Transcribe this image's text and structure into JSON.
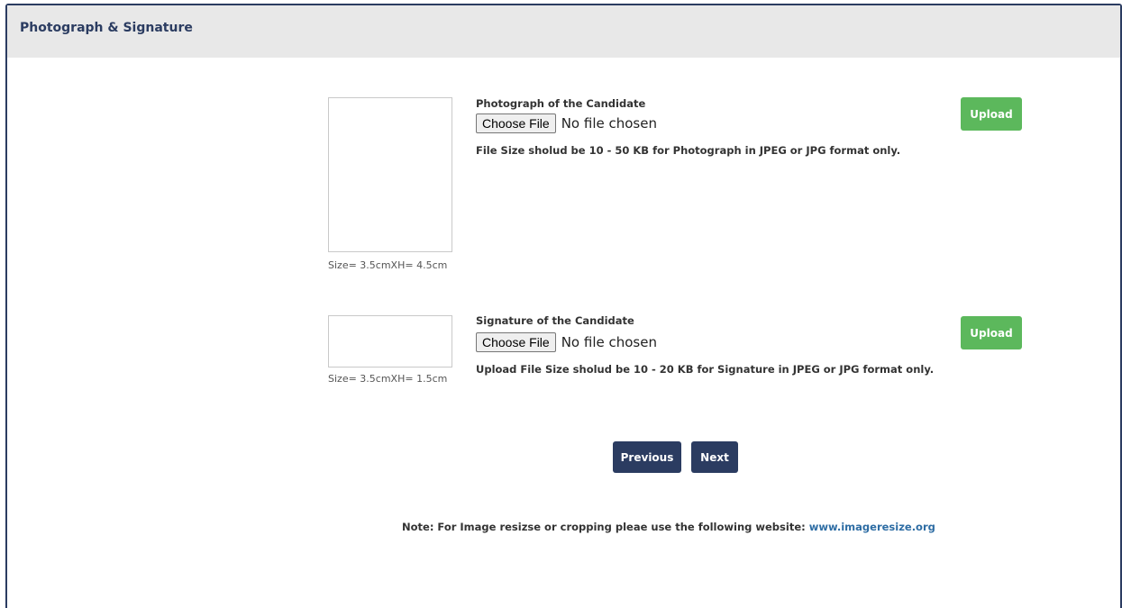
{
  "panel": {
    "title": "Photograph & Signature"
  },
  "photo": {
    "label": "Photograph of the Candidate",
    "choose_label": "Choose File",
    "file_status": "No file chosen",
    "hint": "File Size sholud be 10 - 50 KB for Photograph in JPEG or JPG format only.",
    "size_caption": "Size= 3.5cmXH= 4.5cm",
    "upload_label": "Upload"
  },
  "signature": {
    "label": "Signature of the Candidate",
    "choose_label": "Choose File",
    "file_status": "No file chosen",
    "hint": "Upload File Size sholud be 10 - 20 KB for Signature in JPEG or JPG format only.",
    "size_caption": "Size= 3.5cmXH= 1.5cm",
    "upload_label": "Upload"
  },
  "navigation": {
    "previous_label": "Previous",
    "next_label": "Next"
  },
  "note": {
    "text": "Note: For Image resizse or cropping pleae use the following website: ",
    "link_text": "www.imageresize.org"
  },
  "colors": {
    "header_bg": "#e8e8e8",
    "title_text": "#2b3c61",
    "upload_green": "#5cb85c",
    "nav_button": "#2b3c61",
    "link": "#2e6da4"
  }
}
